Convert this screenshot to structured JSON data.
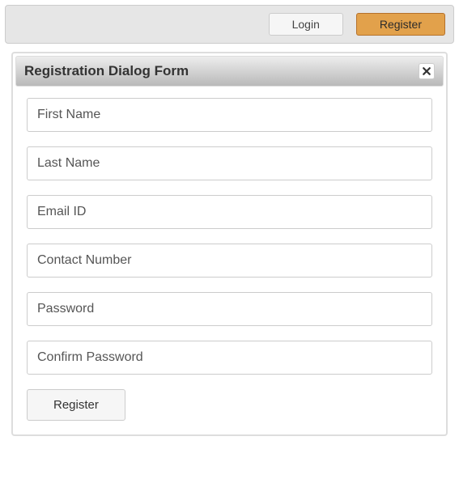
{
  "toolbar": {
    "login_label": "Login",
    "register_label": "Register"
  },
  "dialog": {
    "title": "Registration Dialog Form",
    "fields": {
      "first_name": {
        "placeholder": "First Name",
        "value": ""
      },
      "last_name": {
        "placeholder": "Last Name",
        "value": ""
      },
      "email": {
        "placeholder": "Email ID",
        "value": ""
      },
      "contact": {
        "placeholder": "Contact Number",
        "value": ""
      },
      "password": {
        "placeholder": "Password",
        "value": ""
      },
      "confirm_password": {
        "placeholder": "Confirm Password",
        "value": ""
      }
    },
    "submit_label": "Register"
  }
}
